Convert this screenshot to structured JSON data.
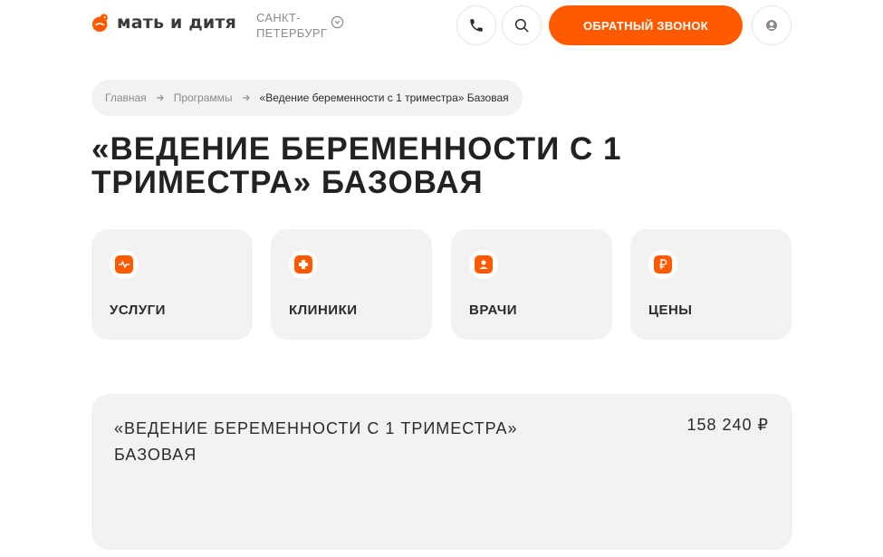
{
  "header": {
    "logo_text": "мать и дитя",
    "city": "САНКТ-ПЕТЕРБУРГ",
    "callback_label": "ОБРАТНЫЙ ЗВОНОК"
  },
  "breadcrumb": {
    "items": [
      "Главная",
      "Программы"
    ],
    "current": "«Ведение беременности с 1 триместра» Базовая"
  },
  "page_title": "«Ведение беременности с 1 триместра» Базовая",
  "cards": [
    {
      "label": "УСЛУГИ",
      "icon": "pulse-icon"
    },
    {
      "label": "КЛИНИКИ",
      "icon": "medical-cross-icon"
    },
    {
      "label": "ВРАЧИ",
      "icon": "doctor-icon"
    },
    {
      "label": "ЦЕНЫ",
      "icon": "ruble-icon"
    }
  ],
  "program": {
    "title": "«Ведение беременности с 1 триместра» Базовая",
    "price": "158 240 ₽"
  },
  "colors": {
    "accent": "#ff5a00",
    "card_bg": "#f2f2f2",
    "text": "#2b2b2b",
    "muted": "#8b8b8b"
  }
}
